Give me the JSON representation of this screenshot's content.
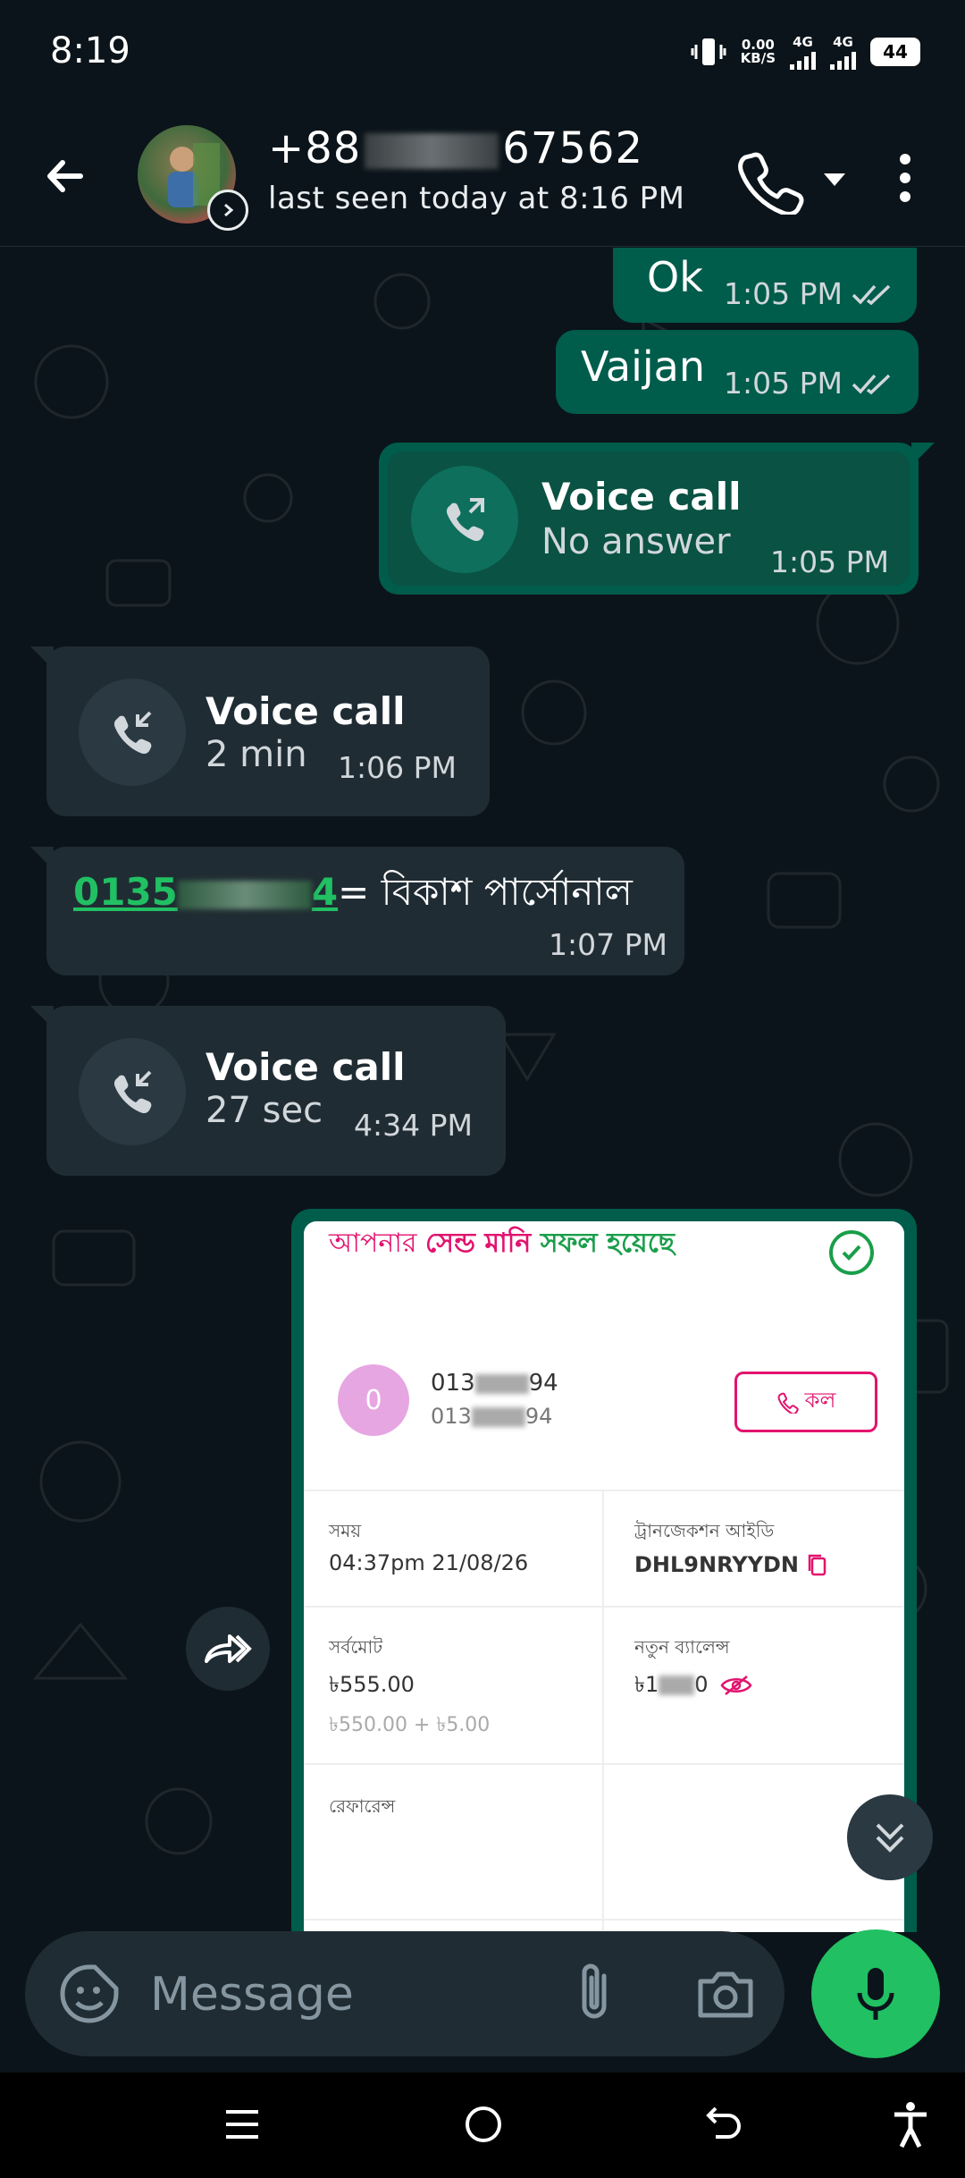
{
  "status_bar": {
    "time": "8:19",
    "net_speed": "0.00",
    "net_unit": "KB/S",
    "sim1": "4G",
    "sim2": "4G",
    "battery": "44"
  },
  "header": {
    "contact_prefix": "+88",
    "contact_suffix": "67562",
    "last_seen": "last seen today at 8:16 PM"
  },
  "messages": {
    "m1": {
      "text": "Ok",
      "time": "1:05 PM"
    },
    "m2": {
      "text": "Vaijan",
      "time": "1:05 PM"
    },
    "call1": {
      "title": "Voice call",
      "subtitle": "No answer",
      "time": "1:05 PM"
    },
    "call2": {
      "title": "Voice call",
      "subtitle": "2 min",
      "time": "1:06 PM"
    },
    "m3": {
      "link_prefix": "0135",
      "link_suffix": "4",
      "text": "= বিকাশ পার্সোনাল",
      "time": "1:07 PM"
    },
    "call3": {
      "title": "Voice call",
      "subtitle": "27 sec",
      "time": "4:34 PM"
    }
  },
  "receipt": {
    "head_a": "আপনার ",
    "head_b": "সেন্ড মানি",
    "head_c": " সফল হয়েছে",
    "avatar_letter": "0",
    "num_prefix": "013",
    "num_suffix": "94",
    "call_label": "কল",
    "time_label": "সময়",
    "time_value": "04:37pm 21/08/26",
    "txn_label": "ট্রানজেকশন আইডি",
    "txn_value": "DHL9NRYYDN",
    "total_label": "সর্বমোট",
    "total_value": "৳555.00",
    "total_breakdown": "৳550.00 + ৳5.00",
    "balance_label": "নতুন ব্যালেন্স",
    "balance_prefix": "৳1",
    "balance_suffix": "0",
    "reference_label": "রেফারেন্স"
  },
  "input": {
    "placeholder": "Message"
  },
  "colors": {
    "accent": "#21c063",
    "outgoing": "#005c4b",
    "incoming": "#202c33",
    "bkash": "#e2136e"
  }
}
